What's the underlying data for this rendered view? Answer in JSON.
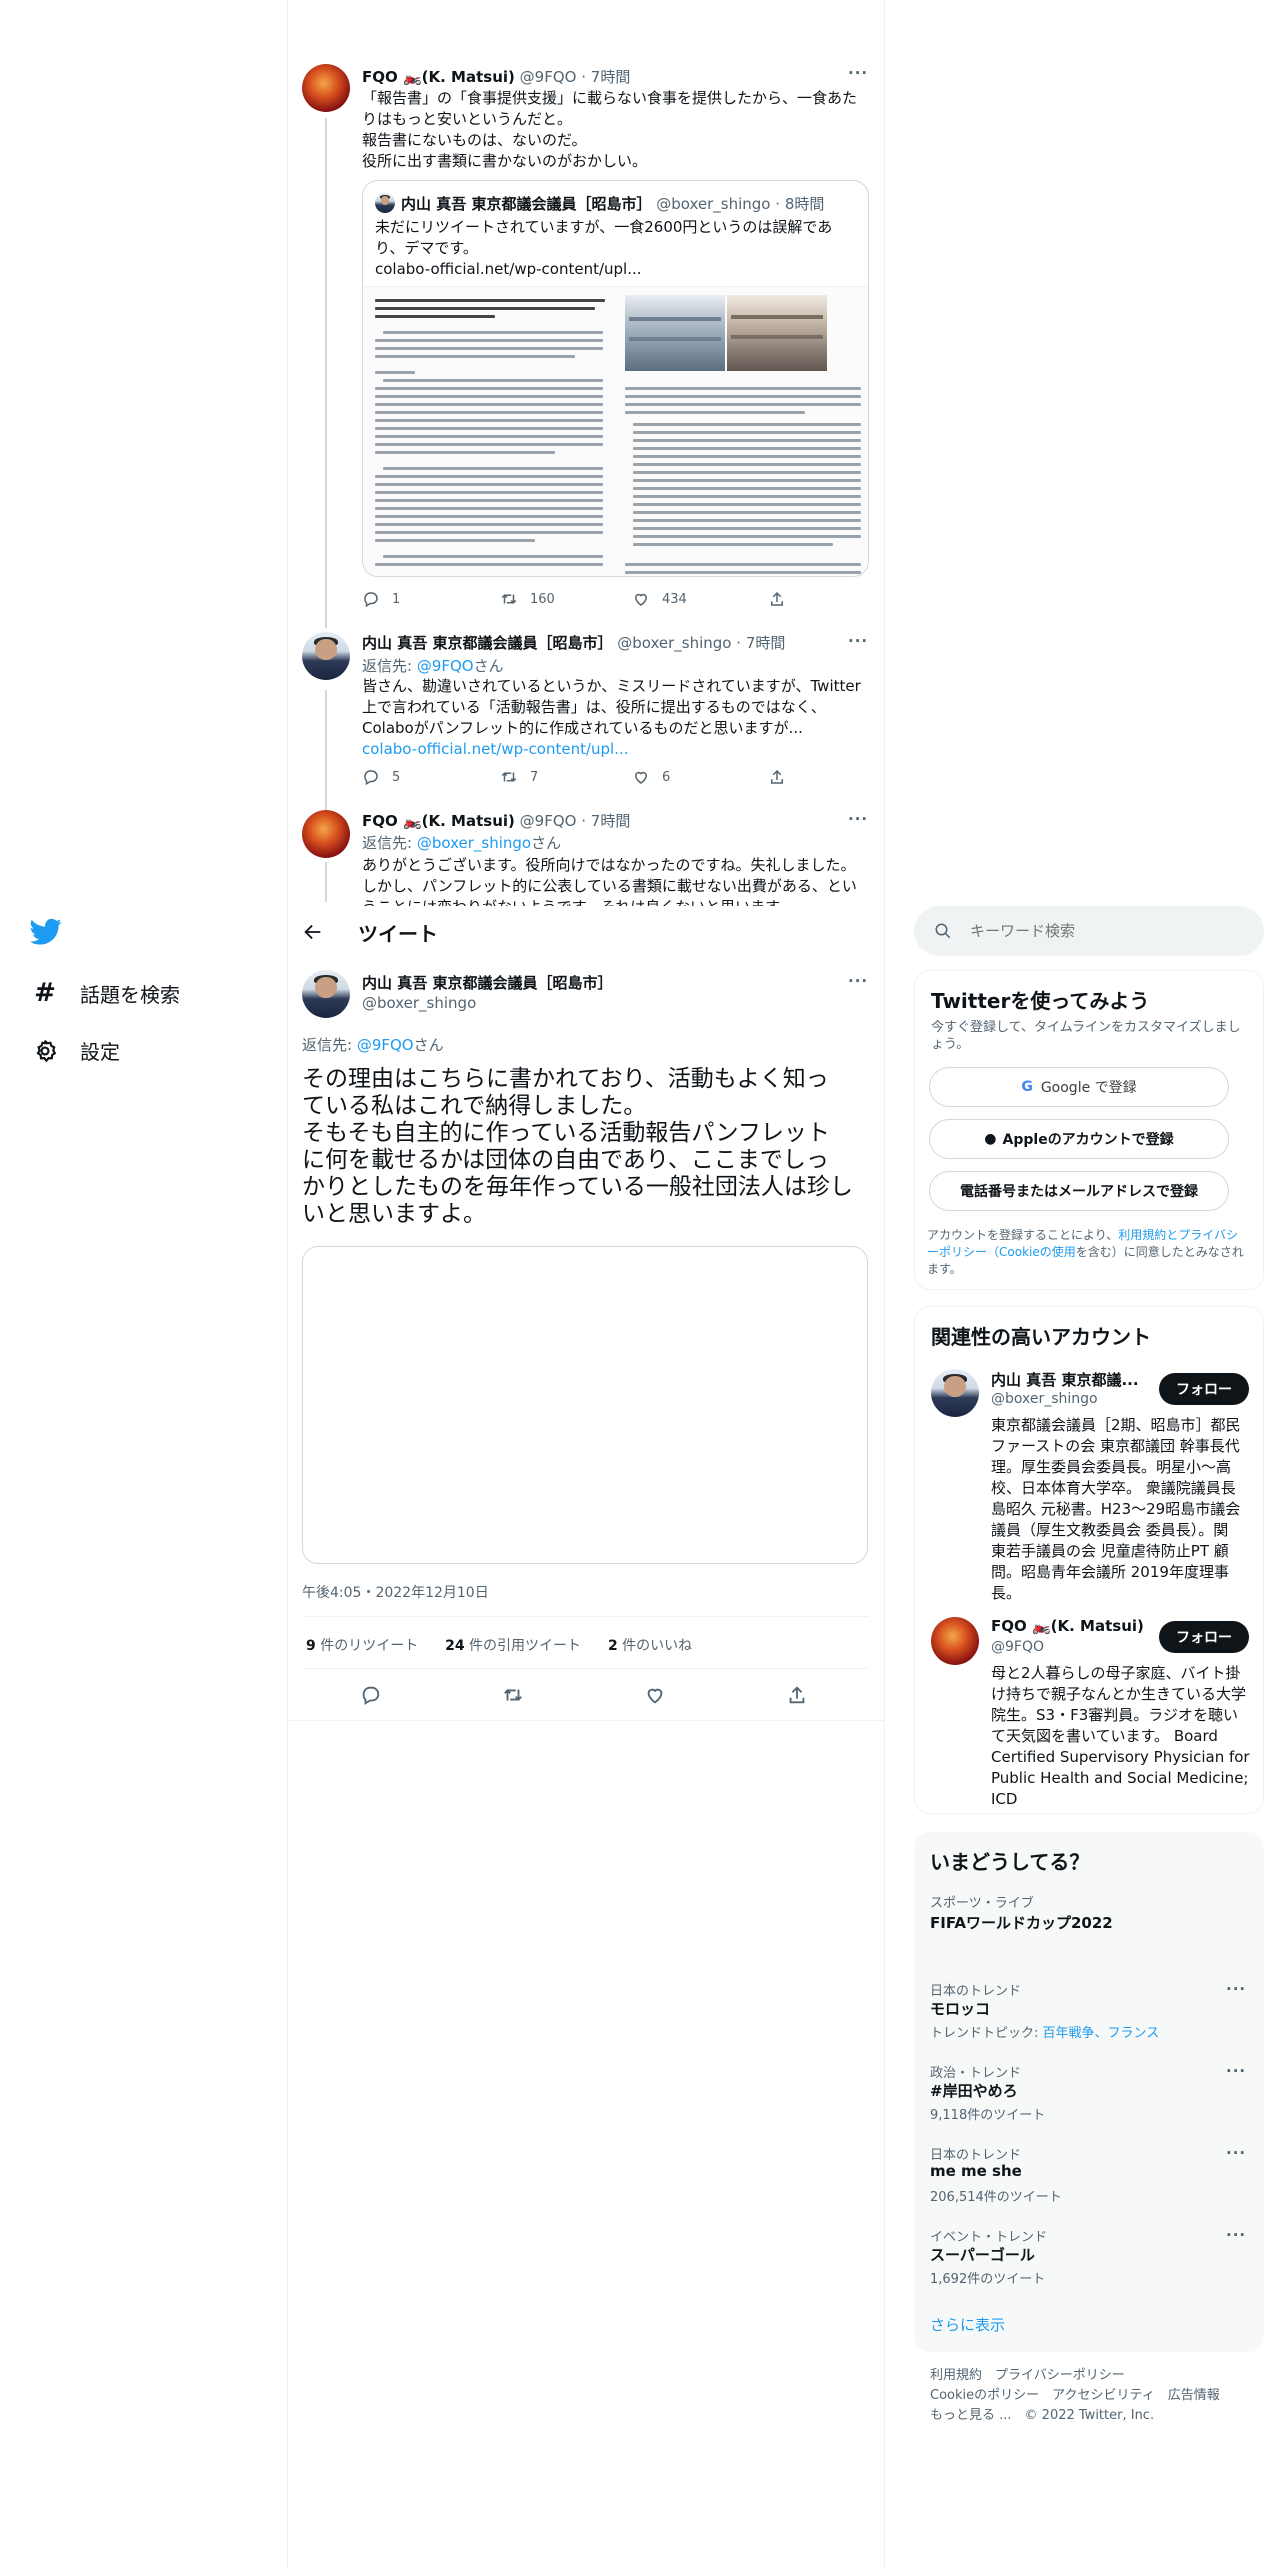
{
  "thread": {
    "tweet1": {
      "name": "FQO 🏍️(K. Matsui)",
      "handle": "@9FQO",
      "time": "7時間",
      "lines": [
        "「報告書」の「食事提供支援」に載らない食事を提供したから、一食あた",
        "りはもっと安いというんだと。",
        "報告書にないものは、ないのだ。",
        "役所に出す書類に書かないのがおかしい。"
      ],
      "quote": {
        "name": "内山 真吾 東京都議会議員［昭島市］",
        "handle": "@boxer_shingo",
        "time": "8時間",
        "lines": [
          "未だにリツイートされていますが、一食2600円というのは誤解であ",
          "り、デマです。",
          "colabo-official.net/wp-content/upl..."
        ]
      },
      "replies": "1",
      "retweets": "160",
      "likes": "434"
    },
    "tweet2": {
      "name": "内山 真吾 東京都議会議員［昭島市］",
      "handle": "@boxer_shingo",
      "time": "7時間",
      "reply_to_label": "返信先: ",
      "reply_to": "@9FQO",
      "reply_suffix": "さん",
      "lines": [
        "皆さん、勘違いされているというか、ミスリードされていますが、Twitter",
        "上で言われている「活動報告書」は、役所に提出するものではなく、",
        "Colaboがパンフレット的に作成されているものだと思いますが..."
      ],
      "link": "colabo-official.net/wp-content/upl...",
      "replies": "5",
      "retweets": "7",
      "likes": "6"
    },
    "tweet3": {
      "name": "FQO 🏍️(K. Matsui)",
      "handle": "@9FQO",
      "time": "7時間",
      "reply_to_label": "返信先: ",
      "reply_to": "@boxer_shingo",
      "reply_suffix": "さん",
      "lines": [
        "ありがとうございます。役所向けではなかったのですね。失礼しました。",
        "しかし、パンフレット的に公表している書類に載せない出費がある、とい",
        "うことには変わりがないようです。それは良くないと思います。"
      ]
    }
  },
  "header": {
    "title": "ツイート"
  },
  "main_tweet": {
    "name": "内山 真吾 東京都議会議員［昭島市］",
    "handle": "@boxer_shingo",
    "reply_to_label": "返信先: ",
    "reply_to": "@9FQO",
    "reply_suffix": "さん",
    "lines": [
      "その理由はこちらに書かれており、活動もよく知っ",
      "ている私はこれで納得しました。",
      "そもそも自主的に作っている活動報告パンフレット",
      "に何を載せるかは団体の自由であり、ここまでしっ",
      "かりとしたものを毎年作っている一般社団法人は珍し",
      "いと思いますよ。"
    ],
    "timestamp": "午後4:05・2022年12月10日",
    "retweets_count": "9",
    "retweets_label": " 件のリツイート",
    "quotes_count": "24",
    "quotes_label": " 件の引用ツイート",
    "likes_count": "2",
    "likes_label": " 件のいいね"
  },
  "left_nav": {
    "explore": "話題を検索",
    "settings": "設定"
  },
  "search": {
    "placeholder": "キーワード検索"
  },
  "signup": {
    "title": "Twitterを使ってみよう",
    "subtitle": "今すぐ登録して、タイムラインをカスタマイズしましょう。",
    "google": "Google で登録",
    "apple": "Appleのアカウントで登録",
    "phone": "電話番号またはメールアドレスで登録",
    "terms_pre": "アカウントを登録することにより、",
    "terms_link": "利用規約とプライバシーポリシー（Cookieの使用",
    "terms_post": "を含む）に同意したとみなされます。"
  },
  "related": {
    "title": "関連性の高いアカウント",
    "accounts": [
      {
        "name": "内山 真吾 東京都議...",
        "handle": "@boxer_shingo",
        "follow": "フォロー",
        "bio_lines": [
          "東京都議会議員［2期、昭島市］都民",
          "ファーストの会 東京都議団 幹事長代",
          "理。厚生委員会委員長。明星小〜高",
          "校、日本体育大学卒。 衆議院議員長",
          "島昭久 元秘書。H23〜29昭島市議会",
          "議員（厚生文教委員会 委員長）。関",
          "東若手議員の会 児童虐待防止PT 顧",
          "問。昭島青年会議所 2019年度理事",
          "長。"
        ]
      },
      {
        "name": "FQO 🏍️(K. Matsui)",
        "handle": "@9FQO",
        "follow": "フォロー",
        "bio_lines": [
          "母と2人暮らしの母子家庭、バイト掛",
          "け持ちで親子なんとか生きている大学",
          "院生。S3・F3審判員。ラジオを聴い",
          "て天気図を書いています。 Board",
          "Certified Supervisory Physician for",
          "Public Health and Social Medicine;",
          "ICD"
        ]
      }
    ]
  },
  "trends": {
    "title": "いまどうしてる？",
    "items": [
      {
        "context": "スポーツ・ライブ",
        "name": "FIFAワールドカップ2022",
        "extra": ""
      },
      {
        "context": "日本のトレンド",
        "name": "モロッコ",
        "extra_pre": "トレンドトピック: ",
        "extra_link": "百年戦争、フランス"
      },
      {
        "context": "政治・トレンド",
        "name": "#岸田やめろ",
        "extra": "9,118件のツイート"
      },
      {
        "context": "日本のトレンド",
        "name": "me me she",
        "extra": "206,514件のツイート"
      },
      {
        "context": "イベント・トレンド",
        "name": "スーパーゴール",
        "extra": "1,692件のツイート"
      }
    ],
    "show_more": "さらに表示"
  },
  "footer": {
    "terms": "利用規約",
    "privacy": "プライバシーポリシー",
    "cookie": "Cookieのポリシー",
    "accessibility": "アクセシビリティ",
    "ads": "広告情報",
    "more": "もっと見る ...",
    "copyright": "© 2022 Twitter, Inc."
  },
  "colors": {
    "accent": "#1d9bf0",
    "text": "#0f1419",
    "muted": "#536471"
  }
}
